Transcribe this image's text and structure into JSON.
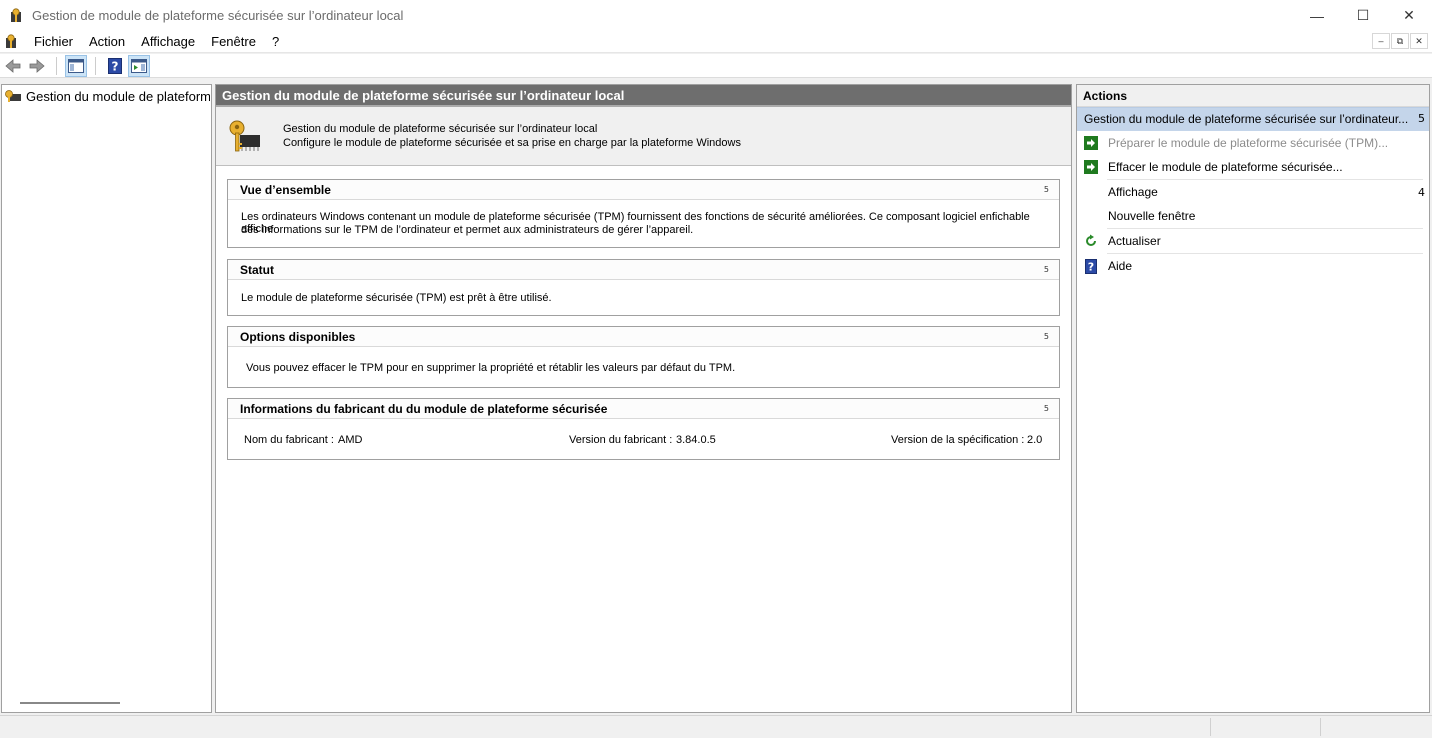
{
  "window": {
    "title": "Gestion de module de plateforme sécurisée sur l’ordinateur local",
    "min_glyph": "—",
    "max_glyph": "☐",
    "close_glyph": "✕"
  },
  "menu": {
    "items": [
      "Fichier",
      "Action",
      "Affichage",
      "Fenêtre",
      "?"
    ],
    "mdi_min": "–",
    "mdi_restore": "⧉",
    "mdi_close": "✕"
  },
  "toolbar": {
    "icons": [
      "back-arrow-icon",
      "forward-arrow-icon",
      "show-hide-console-tree-icon",
      "help-icon",
      "show-hide-action-pane-icon"
    ]
  },
  "tree": {
    "root_label": "Gestion du module de plateforme sécurisée sur l’ordinateur local"
  },
  "center": {
    "header": "Gestion du module de plateforme sécurisée sur l’ordinateur local",
    "intro_line1": "Gestion du module de plateforme sécurisée sur l’ordinateur local",
    "intro_line2": "Configure le module de plateforme sécurisée et sa prise en charge par la plateforme Windows",
    "collapse_glyph": "5",
    "overview": {
      "title": "Vue d’ensemble",
      "line1": "Les ordinateurs Windows contenant un module de plateforme sécurisée (TPM) fournissent des fonctions de sécurité améliorées. Ce composant logiciel enfichable affiche",
      "line2": "des informations sur le TPM de l’ordinateur et permet aux administrateurs de gérer l’appareil."
    },
    "status": {
      "title": "Statut",
      "text": "Le module de plateforme sécurisée (TPM) est prêt à être utilisé."
    },
    "options": {
      "title": "Options disponibles",
      "text": "Vous pouvez effacer le TPM pour en supprimer la propriété et rétablir les valeurs par défaut du TPM."
    },
    "manufacturer": {
      "title": "Informations du fabricant du du module de plateforme sécurisée",
      "name_label": "Nom du fabricant :",
      "name_value": "AMD",
      "version_label": "Version du fabricant :",
      "version_value": "3.84.0.5",
      "spec_label": "Version de la spécification :",
      "spec_value": "2.0"
    }
  },
  "actions": {
    "header": "Actions",
    "group_label": "Gestion du module de plateforme sécurisée sur l’ordinateur...",
    "group_arrow": "5",
    "prepare": "Préparer le module de plateforme sécurisée (TPM)...",
    "clear": "Effacer le module de plateforme sécurisée...",
    "view": "Affichage",
    "view_arrow": "4",
    "new_window": "Nouvelle fenêtre",
    "refresh": "Actualiser",
    "help": "Aide"
  },
  "colors": {
    "header_dark": "#6e6e6e",
    "selection_blue": "#c4d5ea",
    "action_green": "#1f7a1f",
    "help_blue": "#2b4aa6"
  }
}
